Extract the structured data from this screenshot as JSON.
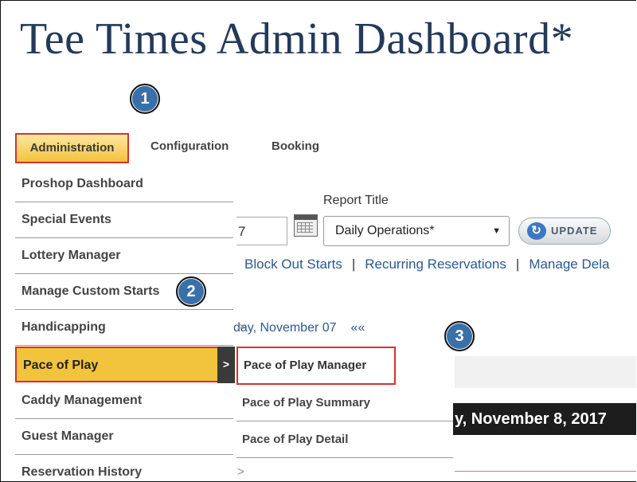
{
  "title": "Tee Times Admin Dashboard*",
  "callouts": [
    "1",
    "2",
    "3"
  ],
  "nav": {
    "administration": "Administration",
    "configuration": "Configuration",
    "booking": "Booking"
  },
  "menu": [
    {
      "label": "Proshop Dashboard"
    },
    {
      "label": "Special Events"
    },
    {
      "label": "Lottery Manager"
    },
    {
      "label": "Manage Custom Starts"
    },
    {
      "label": "Handicapping"
    },
    {
      "label": "Pace of Play"
    },
    {
      "label": "Caddy Management"
    },
    {
      "label": "Guest Manager"
    },
    {
      "label": "Reservation History"
    }
  ],
  "submenu": [
    {
      "label": "Pace of Play Manager"
    },
    {
      "label": "Pace of Play Summary"
    },
    {
      "label": "Pace of Play Detail"
    }
  ],
  "report": {
    "label": "Report Title",
    "date_value": "7",
    "selected": "Daily Operations*",
    "update_label": "UPDATE"
  },
  "links": [
    "Block Out Starts",
    "Recurring Reservations",
    "Manage Dela"
  ],
  "link_separator": "|",
  "date_nav": {
    "text": "day, November 07",
    "prev": "««"
  },
  "banner_date": "y, November 8, 2017",
  "icons": {
    "calendar": "calendar-icon",
    "refresh": "refresh-icon",
    "chevron": "chevron-right-icon",
    "dropdown": "caret-down-icon"
  },
  "colors": {
    "title": "#233a5a",
    "highlight": "#f2c33d",
    "callout": "#3b6fa8",
    "outline": "#d63232",
    "link": "#2b5a8e"
  }
}
